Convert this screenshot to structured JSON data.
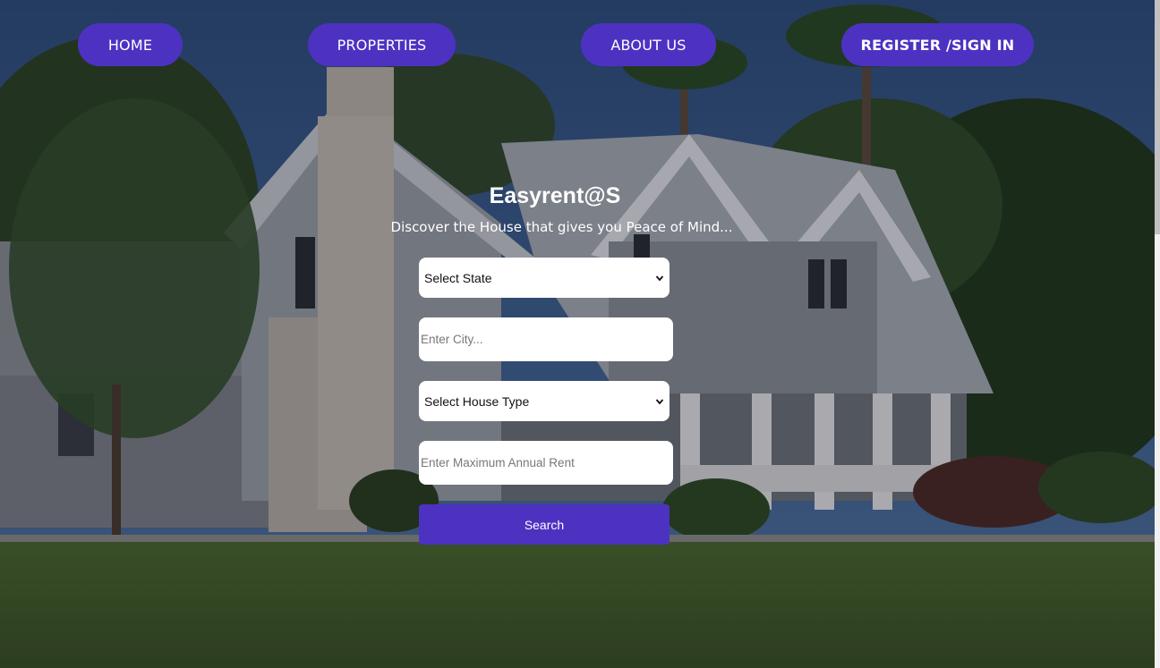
{
  "nav": {
    "home_label": "HOME",
    "properties_label": "PROPERTIES",
    "about_label": "ABOUT US",
    "register_label": "REGISTER /SIGN IN"
  },
  "hero": {
    "brand": "Easyrent@S",
    "tagline": "Discover the House that gives you Peace of Mind..."
  },
  "search_form": {
    "state_select_value": "Select State",
    "city_placeholder": "Enter City...",
    "house_type_select_value": "Select House Type",
    "rent_placeholder": "Enter Maximum Annual Rent",
    "search_label": "Search"
  },
  "colors": {
    "accent": "#4d32c2",
    "text_on_dark": "#ffffff",
    "field_background": "#ffffff"
  },
  "icons": {
    "select_arrow": "chevron-down-icon"
  },
  "background": {
    "description_icon": "house-photo"
  }
}
